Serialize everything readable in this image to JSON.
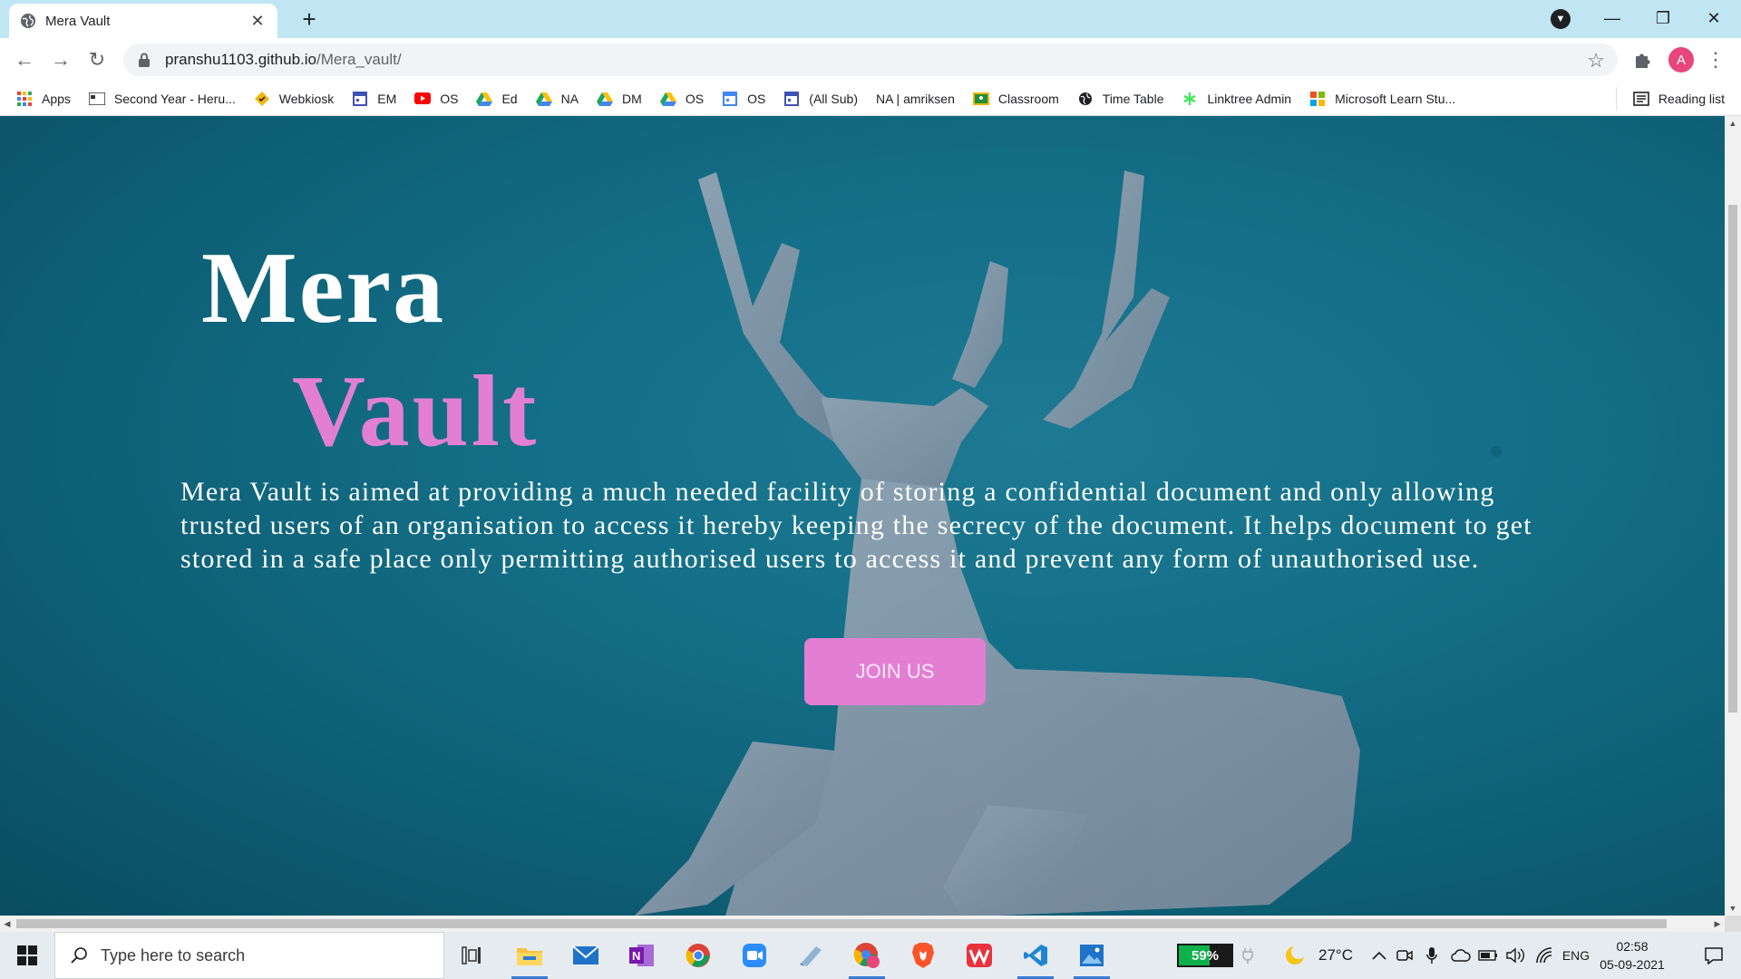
{
  "browser": {
    "tab_title": "Mera Vault",
    "url_host": "pranshu1103.github.io",
    "url_path": "/Mera_vault/",
    "profile_initial": "A"
  },
  "bookmarks": [
    {
      "label": "Apps",
      "icon": "apps-grid-icon",
      "color": "#ea4335"
    },
    {
      "label": "Second Year - Heru...",
      "icon": "site-icon",
      "color": "#333333"
    },
    {
      "label": "Webkiosk",
      "icon": "webkiosk-icon",
      "color": "#f2b705"
    },
    {
      "label": "EM",
      "icon": "calendar-icon",
      "color": "#3f51b5"
    },
    {
      "label": "OS",
      "icon": "youtube-icon",
      "color": "#ff0000"
    },
    {
      "label": "Ed",
      "icon": "google-drive-icon",
      "color": "#1fa463"
    },
    {
      "label": "NA",
      "icon": "google-drive-icon",
      "color": "#1fa463"
    },
    {
      "label": "DM",
      "icon": "google-drive-icon",
      "color": "#1fa463"
    },
    {
      "label": "OS",
      "icon": "google-drive-icon",
      "color": "#1fa463"
    },
    {
      "label": "OS",
      "icon": "calendar-icon",
      "color": "#4285f4"
    },
    {
      "label": "(All Sub)",
      "icon": "calendar-icon",
      "color": "#3f51b5"
    },
    {
      "label": "NA | amriksen",
      "icon": "",
      "color": ""
    },
    {
      "label": "Classroom",
      "icon": "classroom-icon",
      "color": "#f4b400"
    },
    {
      "label": "Time Table",
      "icon": "globe-icon",
      "color": "#202124"
    },
    {
      "label": "Linktree Admin",
      "icon": "linktree-icon",
      "color": "#43e660"
    },
    {
      "label": "Microsoft Learn Stu...",
      "icon": "microsoft-icon",
      "color": "#f25022"
    }
  ],
  "reading_list": "Reading list",
  "page": {
    "title_line1": "Mera",
    "title_line2": "Vault",
    "description": "Mera Vault is aimed at providing a much needed facility of storing a confidential document and only allowing trusted users of an organisation to access it hereby keeping the secrecy of the document. It helps document to get stored in a safe place only permitting authorised users to access it and prevent any form of unauthorised use.",
    "join_label": "JOIN US",
    "accent_color": "#e37fd2",
    "background_color": "#136f87"
  },
  "taskbar": {
    "search_placeholder": "Type here to search",
    "battery_percent": "59%",
    "battery_level": 0.59,
    "temperature": "27°C",
    "language": "ENG",
    "time": "02:58",
    "date": "05-09-2021"
  }
}
